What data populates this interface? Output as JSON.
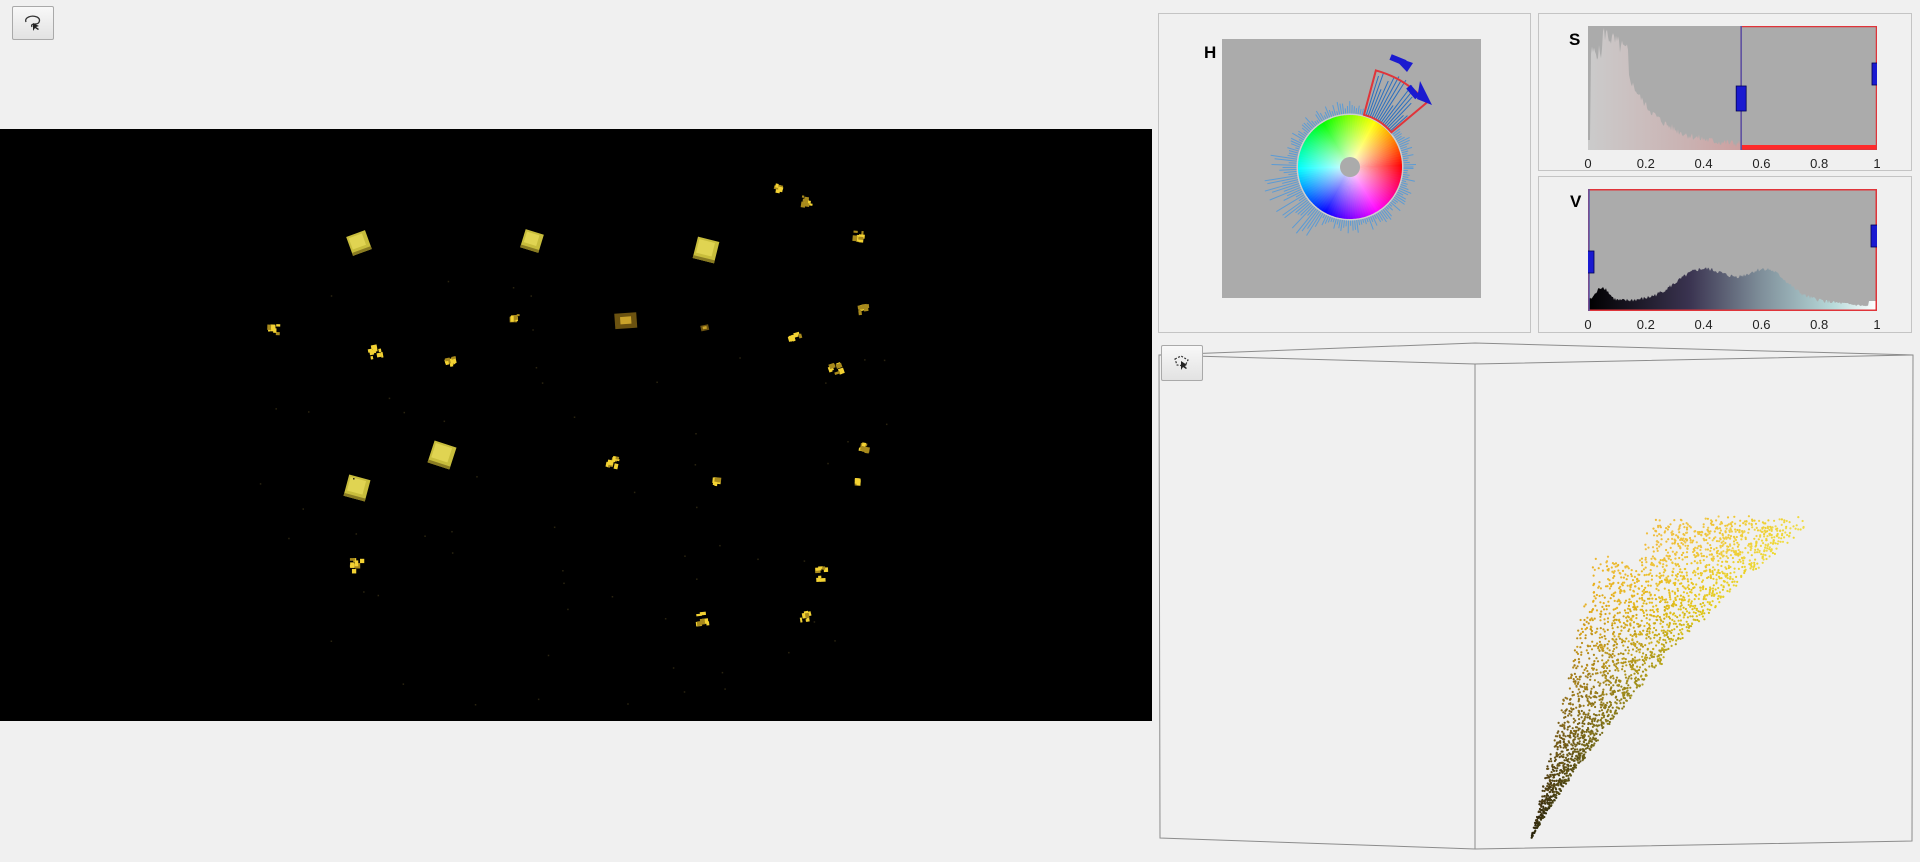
{
  "toolbar": {
    "top_left_tool_icon": "lasso-select-icon",
    "cloud_tool_icon": "polygon-select-icon"
  },
  "hue_panel": {
    "label": "H",
    "selection_color": "#e0343a",
    "handle_color": "#1a1ad0"
  },
  "saturation_panel": {
    "label": "S",
    "ticks": [
      "0",
      "0.2",
      "0.4",
      "0.6",
      "0.8",
      "1"
    ],
    "selected_range": [
      0.53,
      1.0
    ],
    "selection_color": "#e0343a",
    "handle_color": "#1a1ad0"
  },
  "value_panel": {
    "label": "V",
    "ticks": [
      "0",
      "0.2",
      "0.4",
      "0.6",
      "0.8",
      "1"
    ],
    "selected_range": [
      0.0,
      1.0
    ],
    "selection_color": "#e0343a",
    "handle_color": "#1a1ad0"
  },
  "colors": {
    "background": "#f0f0f0",
    "histogram_gray": "#ababab",
    "image_background": "#000000",
    "object_yellow": "#d8c84a"
  }
}
